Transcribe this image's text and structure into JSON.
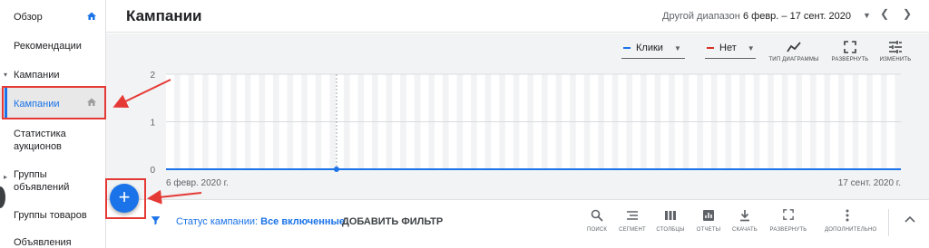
{
  "sidebar": {
    "items": [
      {
        "label": "Обзор"
      },
      {
        "label": "Рекомендации"
      },
      {
        "label": "Кампании"
      },
      {
        "label": "Кампании"
      },
      {
        "label": "Статистика аукционов"
      },
      {
        "label": "Группы объявлений"
      },
      {
        "label": "Группы товаров"
      },
      {
        "label": "Объявления"
      }
    ]
  },
  "header": {
    "title": "Кампании",
    "range_label": "Другой диапазон",
    "range_value": "6 февр. – 17 сент. 2020"
  },
  "chart_toolbar": {
    "metric1": "Клики",
    "metric2": "Нет",
    "chart_type": "ТИП ДИАГРАММЫ",
    "expand": "РАЗВЕРНУТЬ",
    "edit": "ИЗМЕНИТЬ"
  },
  "chart_data": {
    "type": "line",
    "series": [
      {
        "name": "Клики",
        "color": "#1a73e8",
        "values": [
          0,
          0
        ]
      }
    ],
    "x": [
      "6 февр. 2020 г.",
      "17 сент. 2020 г."
    ],
    "y_ticks": [
      "0",
      "1",
      "2"
    ],
    "ylim": [
      0,
      2
    ],
    "grid": true,
    "highlight_point": {
      "x": "6 февр. 2020 г.",
      "y": 0
    }
  },
  "filter_bar": {
    "status_prefix": "Статус кампании: ",
    "status_value": "Все включенные",
    "add_filter": "ДОБАВИТЬ ФИЛЬТР",
    "tools": {
      "search": "ПОИСК",
      "segment": "СЕГМЕНТ",
      "columns": "СТОЛБЦЫ",
      "reports": "ОТЧЕТЫ",
      "download": "СКАЧАТЬ",
      "expand": "РАЗВЕРНУТЬ",
      "more": "ДОПОЛНИТЕЛЬНО"
    }
  },
  "fab": {
    "label": "+"
  },
  "colors": {
    "accent": "#1a73e8",
    "annotation": "#e53935",
    "metric2": "#d93025"
  }
}
